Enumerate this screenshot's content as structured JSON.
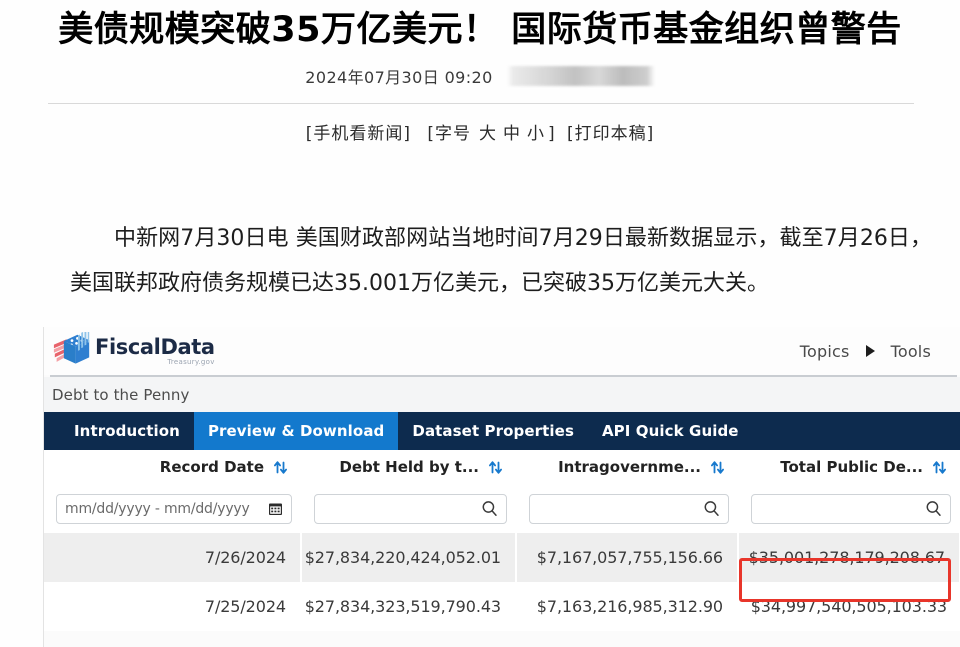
{
  "article": {
    "title": "美债规模突破35万亿美元！ 国际货币基金组织曾警告",
    "date": "2024年07月30日 09:20",
    "source_blurred": "",
    "tools": {
      "mobile": "[手机看新闻]",
      "fontsize_label": "[字号",
      "size_large": "大",
      "size_medium": "中",
      "size_small": "小",
      "fontsize_close": "]",
      "print": "[打印本稿]"
    },
    "body": "中新网7月30日电 美国财政部网站当地时间7月29日最新数据显示，截至7月26日，美国联邦政府债务规模已达35.001万亿美元，已突破35万亿美元大关。"
  },
  "fiscaldata": {
    "logo": {
      "name": "FiscalData",
      "tagline": "Treasury.gov",
      "icon": "fiscaldata-cube-logo"
    },
    "nav": {
      "topics": "Topics",
      "caret": "caret-right-icon",
      "tools": "Tools"
    },
    "breadcrumb": "Debt to the Penny",
    "tabs": [
      {
        "label": "Introduction",
        "active": false
      },
      {
        "label": "Preview & Download",
        "active": true
      },
      {
        "label": "Dataset Properties",
        "active": false
      },
      {
        "label": "API Quick Guide",
        "active": false
      }
    ],
    "table": {
      "columns": [
        {
          "header": "Record Date",
          "sort_icon": "sort-updown-icon"
        },
        {
          "header": "Debt Held by t...",
          "sort_icon": "sort-updown-icon"
        },
        {
          "header": "Intragovernme...",
          "sort_icon": "sort-updown-icon"
        },
        {
          "header": "Total Public De...",
          "sort_icon": "sort-updown-icon"
        }
      ],
      "filters": [
        {
          "type": "daterange",
          "placeholder": "mm/dd/yyyy - mm/dd/yyyy",
          "value": "",
          "icon": "calendar-icon"
        },
        {
          "type": "search",
          "placeholder": "",
          "value": "",
          "icon": "search-icon"
        },
        {
          "type": "search",
          "placeholder": "",
          "value": "",
          "icon": "search-icon"
        },
        {
          "type": "search",
          "placeholder": "",
          "value": "",
          "icon": "search-icon"
        }
      ],
      "rows": [
        {
          "record_date": "7/26/2024",
          "debt_held_by_public": "$27,834,220,424,052.01",
          "intragovernmental": "$7,167,057,755,156.66",
          "total_public_debt": "$35,001,278,179,208.67",
          "highlighted": true
        },
        {
          "record_date": "7/25/2024",
          "debt_held_by_public": "$27,834,323,519,790.43",
          "intragovernmental": "$7,163,216,985,312.90",
          "total_public_debt": "$34,997,540,505,103.33",
          "highlighted": false
        }
      ]
    }
  },
  "colors": {
    "tabbar_bg": "#0d2b4e",
    "tab_active": "#1379cd",
    "highlight_border": "#e8352a",
    "sort_icon": "#1779cd",
    "alt_row": "#eeeeee"
  }
}
